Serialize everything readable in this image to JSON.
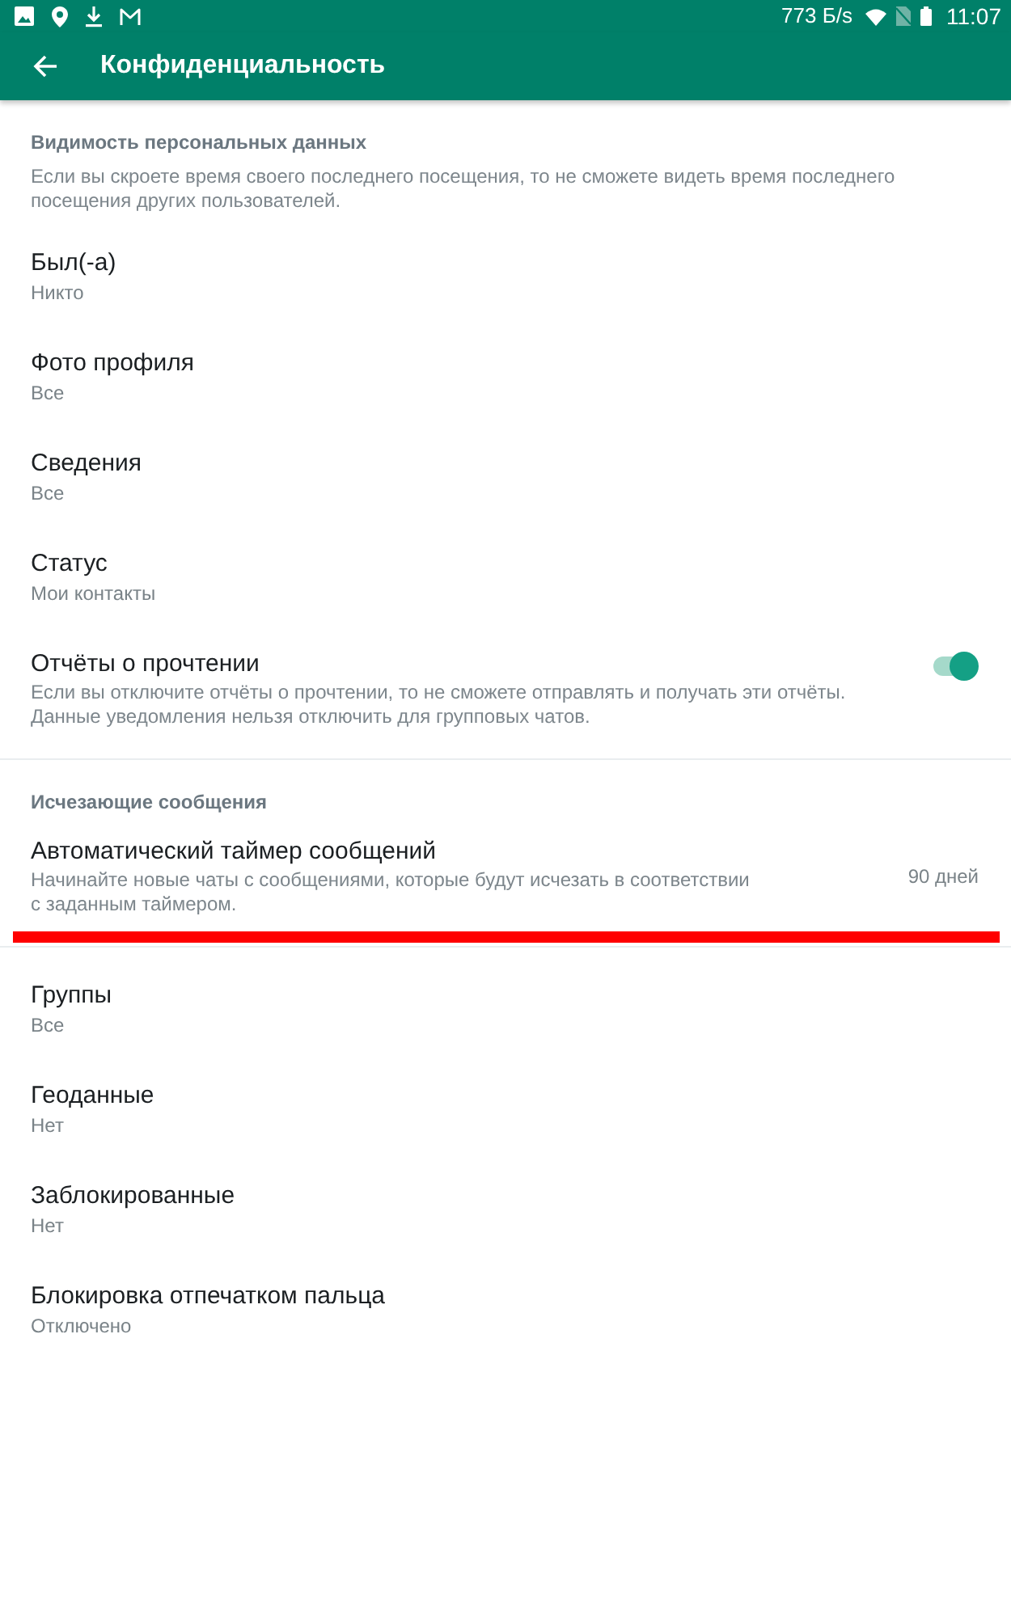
{
  "status_bar": {
    "network_speed": "773 Б/s",
    "time": "11:07"
  },
  "app_bar": {
    "title": "Конфиденциальность"
  },
  "sections": [
    {
      "header": "Видимость персональных данных",
      "description": "Если вы скроете время своего последнего посещения, то не сможете видеть время последнего посещения других пользователей.",
      "items": [
        {
          "kind": "option",
          "title": "Был(-а)",
          "value": "Никто"
        },
        {
          "kind": "option",
          "title": "Фото профиля",
          "value": "Все"
        },
        {
          "kind": "option",
          "title": "Сведения",
          "value": "Все"
        },
        {
          "kind": "option",
          "title": "Статус",
          "value": "Мои контакты"
        },
        {
          "kind": "toggle",
          "title": "Отчёты о прочтении",
          "description": "Если вы отключите отчёты о прочтении, то не сможете отправлять и получать эти отчёты. Данные уведомления нельзя отключить для групповых чатов.",
          "on": true
        }
      ]
    },
    {
      "header": "Исчезающие сообщения",
      "underlined": true,
      "items": [
        {
          "kind": "timer",
          "title": "Автоматический таймер сообщений",
          "description": "Начинайте новые чаты с сообщениями, которые будут исчезать в соответствии с заданным таймером.",
          "value": "90 дней"
        }
      ]
    },
    {
      "items": [
        {
          "kind": "option",
          "title": "Группы",
          "value": "Все"
        },
        {
          "kind": "option",
          "title": "Геоданные",
          "value": "Нет"
        },
        {
          "kind": "option",
          "title": "Заблокированные",
          "value": "Нет"
        },
        {
          "kind": "option",
          "title": "Блокировка отпечатком пальца",
          "value": "Отключено"
        }
      ]
    }
  ]
}
